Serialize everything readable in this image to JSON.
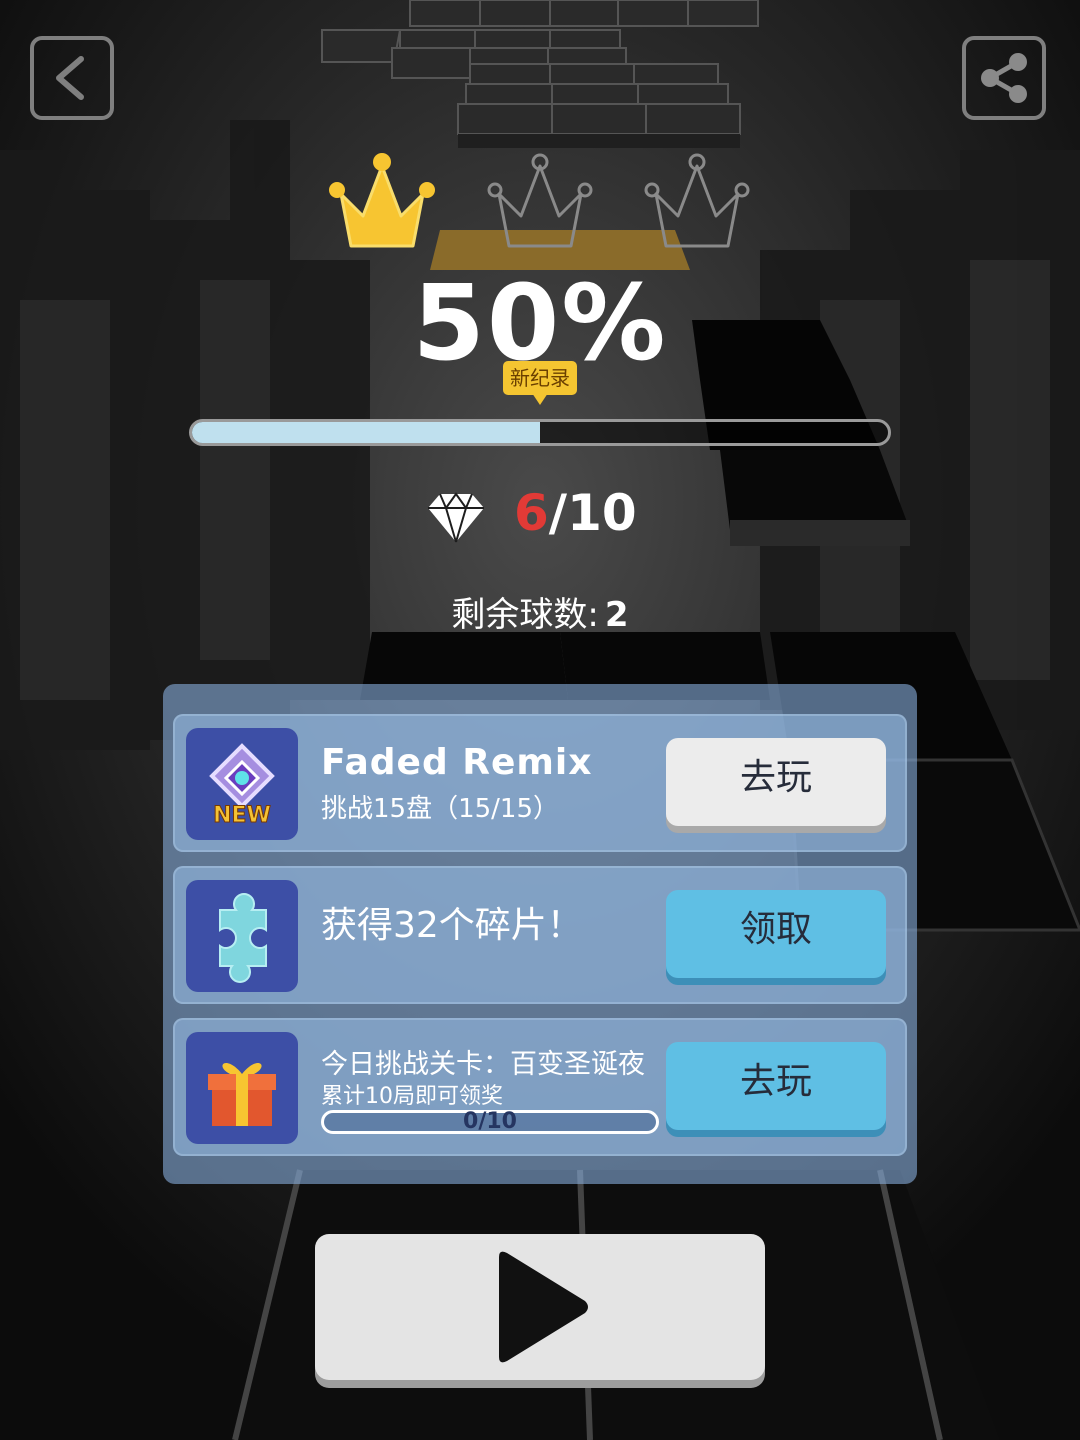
{
  "top_bar": {
    "back_icon": "back-arrow-icon",
    "share_icon": "share-icon"
  },
  "result": {
    "crowns_earned": 1,
    "crowns_total": 3,
    "percent_text": "50%",
    "progress_fraction": 0.5,
    "new_record_label": "新纪录"
  },
  "gems": {
    "current": "6",
    "separator": "/",
    "total": "10"
  },
  "balls": {
    "label": "剩余球数:",
    "count": "2"
  },
  "tasks": [
    {
      "icon": "new-song-icon",
      "title": "Faded Remix",
      "subtitle": "挑战15盘（15/15）",
      "button": "去玩"
    },
    {
      "icon": "puzzle-piece-icon",
      "title": "获得32个碎片！",
      "button": "领取"
    },
    {
      "icon": "gift-box-icon",
      "title": "今日挑战关卡：百变圣诞夜",
      "subtitle": "累计10局即可领奖",
      "progress_text": "0/10",
      "progress_fraction": 0,
      "button": "去玩"
    }
  ],
  "colors": {
    "crown_active": "#f7c531",
    "gem_current": "#e23a36",
    "progress_fill": "#bfe0ee",
    "claim_button": "#5fbfe4"
  }
}
